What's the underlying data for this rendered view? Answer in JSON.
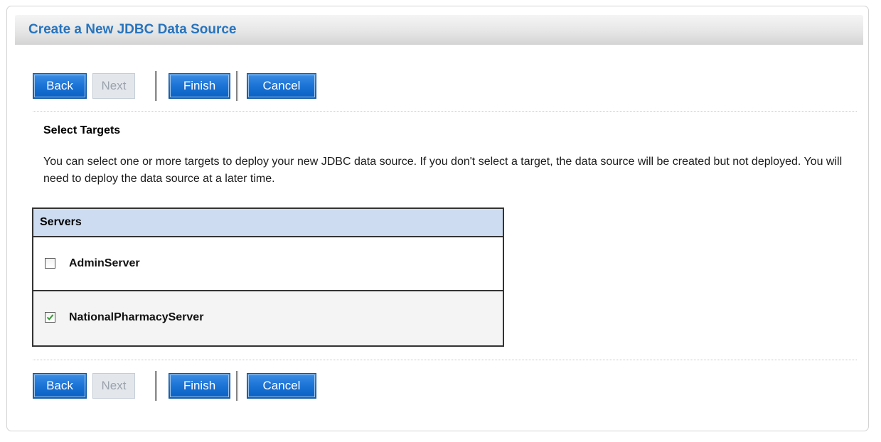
{
  "panel": {
    "title": "Create a New JDBC Data Source"
  },
  "toolbar": {
    "back_label": "Back",
    "next_label": "Next",
    "finish_label": "Finish",
    "cancel_label": "Cancel"
  },
  "section": {
    "title": "Select Targets",
    "description": "You can select one or more targets to deploy your new JDBC data source. If you don't select a target, the data source will be created but not deployed. You will need to deploy the data source at a later time."
  },
  "servers": {
    "header": "Servers",
    "rows": [
      {
        "name": "AdminServer",
        "checked": false
      },
      {
        "name": "NationalPharmacyServer",
        "checked": true
      }
    ]
  },
  "colors": {
    "title_blue": "#2774be",
    "button_blue": "#1b73d6",
    "table_header": "#cddcf0",
    "check_green": "#2e9b2e"
  },
  "icons": {
    "checkbox_checked": "checkmark-icon"
  }
}
